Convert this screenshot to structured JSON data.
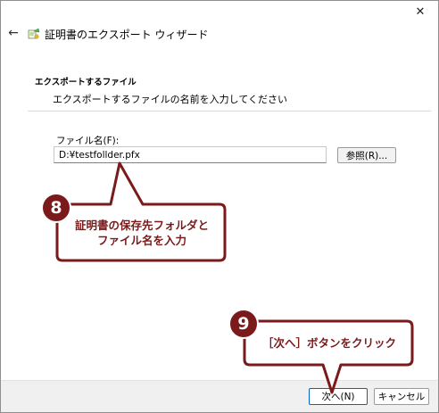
{
  "window": {
    "title": "証明書のエクスポート ウィザード",
    "close_glyph": "✕",
    "back_glyph": "←"
  },
  "page": {
    "heading": "エクスポートするファイル",
    "description": "エクスポートするファイルの名前を入力してください"
  },
  "form": {
    "filename_label": "ファイル名(F):",
    "filename_value": "D:¥testfollder.pfx",
    "browse_label": "参照(R)..."
  },
  "footer": {
    "next_label": "次へ(N)",
    "cancel_label": "キャンセル"
  },
  "annotations": [
    {
      "number": "8",
      "line1": "証明書の保存先フォルダと",
      "line2": "ファイル名を入力"
    },
    {
      "number": "9",
      "line1": "［次へ］ボタンをクリック"
    }
  ],
  "colors": {
    "callout": "#7a1a1a",
    "next_button_border": "#0067c0",
    "footer_bg": "#f0f0f0"
  }
}
